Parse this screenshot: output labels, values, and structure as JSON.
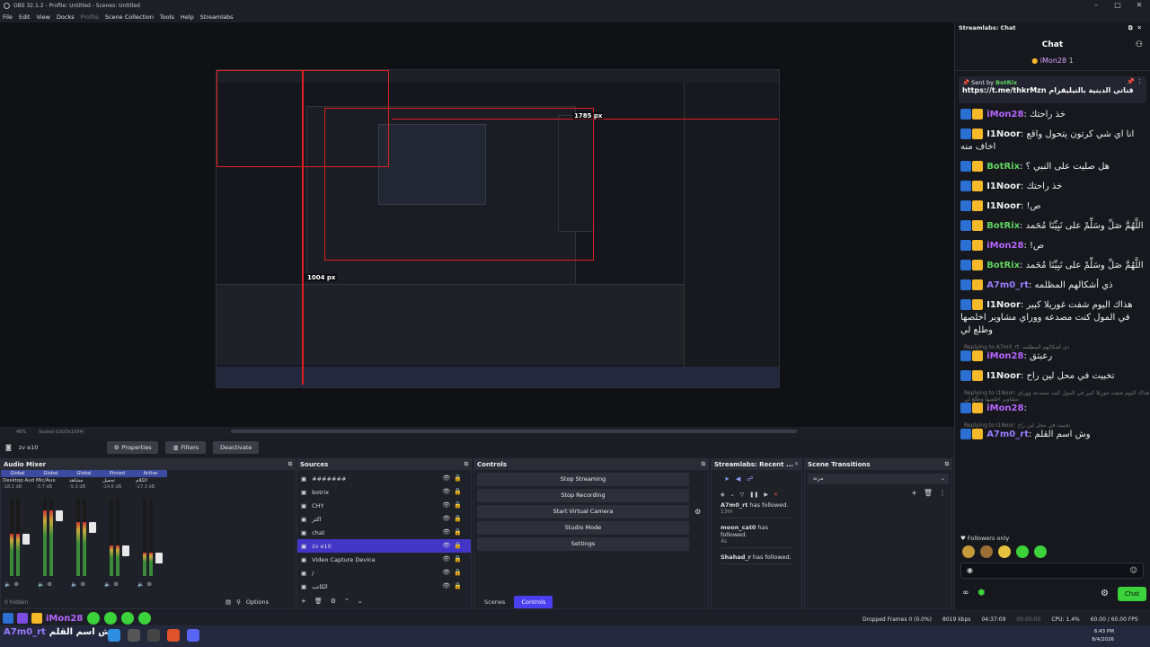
{
  "window": {
    "title": "OBS 32.1.2 - Profile: Untitled - Scenes: Untitled",
    "controls": [
      "–",
      "□",
      "✕"
    ]
  },
  "menu": [
    "File",
    "Edit",
    "View",
    "Docks",
    "Profile",
    "Scene Collection",
    "Tools",
    "Help",
    "Streamlabs"
  ],
  "preview": {
    "label_width": "1785 px",
    "label_height": "1004 px",
    "zoom": "48%",
    "scale": "Scaled (1920x1054)"
  },
  "source_context": {
    "name": "zv e10",
    "properties": "Properties",
    "filters": "Filters",
    "deactivate": "Deactivate"
  },
  "audio_mixer": {
    "title": "Audio Mixer",
    "channels": [
      {
        "head": "Global",
        "name": "Desktop Audio 2",
        "db": "-18.1 dB"
      },
      {
        "head": "Global",
        "name": "Mic/Aux",
        "db": "-3.7 dB"
      },
      {
        "head": "Global",
        "name": "مشاهد",
        "db": "-5.3 dB"
      },
      {
        "head": "Pinned",
        "name": "تحميل",
        "db": "-14.6 dB"
      },
      {
        "head": "Active",
        "name": "الكلام",
        "db": "-17.3 dB"
      }
    ],
    "levels": [
      0.55,
      0.85,
      0.7,
      0.4,
      0.3
    ],
    "hidden": "0 hidden",
    "options": "Options"
  },
  "sources": {
    "title": "Sources",
    "items": [
      {
        "name": "#######",
        "selected": false
      },
      {
        "name": "botrix",
        "selected": false
      },
      {
        "name": "CHY",
        "selected": false
      },
      {
        "name": "اكثر",
        "selected": false
      },
      {
        "name": "chat",
        "selected": false
      },
      {
        "name": "zv e10",
        "selected": true
      },
      {
        "name": "Video Capture Device",
        "selected": false
      },
      {
        "name": "/",
        "selected": false
      },
      {
        "name": "الكاتب",
        "selected": false
      }
    ]
  },
  "controls": {
    "title": "Controls",
    "buttons": [
      "Stop Streaming",
      "Stop Recording",
      "Start Virtual Camera",
      "Studio Mode",
      "Settings"
    ],
    "tabs": [
      "Scenes",
      "Controls"
    ]
  },
  "recent_events": {
    "title": "Streamlabs: Recent ...",
    "events": [
      {
        "user": "A7m0_rt",
        "action": "has followed.",
        "time": "13m"
      },
      {
        "user": "moon_cat0",
        "action": "has followed.",
        "time": "4s"
      },
      {
        "user": "Shahad_r",
        "action": "has followed.",
        "time": ""
      }
    ]
  },
  "scene_transitions": {
    "title": "Scene Transitions",
    "value": "مرنة"
  },
  "chat": {
    "header": "Streamlabs: Chat",
    "title": "Chat",
    "top_user": "iMon28",
    "top_count": "1",
    "pinned": {
      "sent_by": "Sent by",
      "bot": "BotRix",
      "text": "قناتي الدينية بالتيليقرام",
      "link": "https://t.me/thkrMzn"
    },
    "messages": [
      {
        "user": "iMon28",
        "color": "#b565ff",
        "text": "خذ راحتك",
        "reply": ""
      },
      {
        "user": "I1Noor",
        "color": "#eeeeee",
        "text": "انا اي شي كرتون يتحول واقع اخاف منه",
        "reply": ""
      },
      {
        "user": "BotRix",
        "color": "#5fd35f",
        "text": "هل صليت على النبي ؟",
        "reply": ""
      },
      {
        "user": "I1Noor",
        "color": "#eeeeee",
        "text": "خذ راحتك",
        "reply": ""
      },
      {
        "user": "I1Noor",
        "color": "#eeeeee",
        "text": "ص!",
        "reply": ""
      },
      {
        "user": "BotRix",
        "color": "#5fd35f",
        "text": "اللَّهُمَّ صَلِّ وسَلِّمْ على نَبِيِّنَا مُحَمد",
        "reply": ""
      },
      {
        "user": "iMon28",
        "color": "#b565ff",
        "text": "ص!",
        "reply": ""
      },
      {
        "user": "BotRix",
        "color": "#5fd35f",
        "text": "اللَّهُمَّ صَلِّ وسَلِّمْ على نَبِيِّنَا مُحَمد",
        "reply": ""
      },
      {
        "user": "A7m0_rt",
        "color": "#9a7bff",
        "text": "ذي أشكالهم المظلمه",
        "reply": ""
      },
      {
        "user": "I1Noor",
        "color": "#eeeeee",
        "text": "هذاك اليوم شفت غوريلا كبير في المول كنت مصدعه ووراي مشاوير اخلصها وطلع لي",
        "reply": ""
      },
      {
        "user": "iMon28",
        "color": "#b565ff",
        "text": "رعبتق",
        "reply": "Replying to A7m0_rt: ذي أشكالهم المظلمه"
      },
      {
        "user": "I1Noor",
        "color": "#eeeeee",
        "text": "تخبيت في محل لين راح",
        "reply": ""
      },
      {
        "user": "iMon28",
        "color": "#b565ff",
        "text": "",
        "reply": "Replying to I1Noor: هذاك اليوم شفت غوريلا كبير في المول كنت مصدعه ووراي مشاوير اخلصها وطلع لي"
      },
      {
        "user": "A7m0_rt",
        "color": "#9a7bff",
        "text": "وش اسم القلم",
        "reply": "Replying to I1Noor: تخبيت في محل لين راح"
      }
    ],
    "followers_only": "Followers only",
    "send": "Chat"
  },
  "ticker": {
    "user": "iMon28",
    "line2": "A7m0_rt",
    "line2_text": "وش اسم القلم"
  },
  "status": {
    "dropped": "Dropped Frames 0 (0.0%)",
    "kbps": "8019 kbps",
    "stream_time": "04:37:09",
    "rec_time": "00:00:00",
    "cpu": "CPU: 1.4%",
    "fps": "60.00 / 60.00 FPS"
  },
  "taskbar": {
    "time": "6:43 PM",
    "date": "8/4/2026"
  }
}
